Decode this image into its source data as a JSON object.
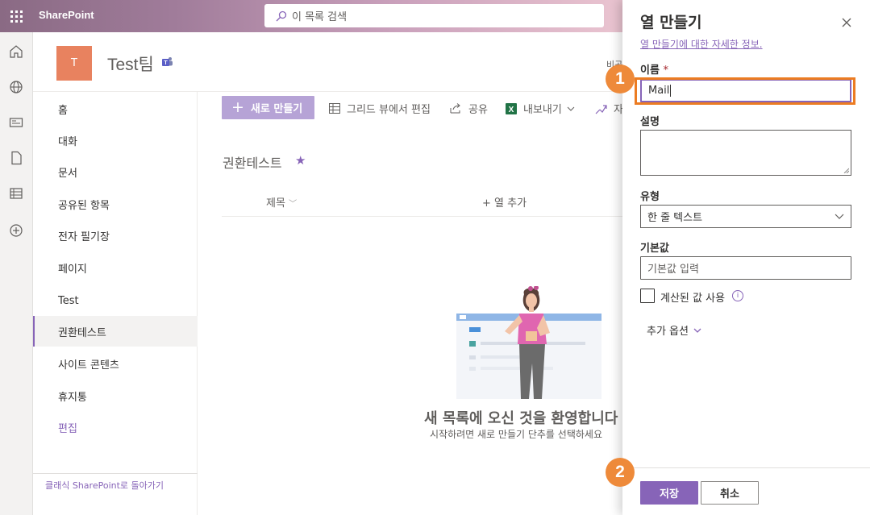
{
  "suite": {
    "brand": "SharePoint",
    "search_placeholder": "이 목록 검색"
  },
  "site": {
    "logo_letter": "T",
    "title": "Test팀",
    "header_right": "비공"
  },
  "nav": {
    "items": [
      "홈",
      "대화",
      "문서",
      "공유된 항목",
      "전자 필기장",
      "페이지",
      "Test",
      "권환테스트",
      "사이트 콘텐츠",
      "휴지통"
    ],
    "edit": "편집",
    "active_index": 7,
    "classic_link": "클래식 SharePoint로 돌아가기"
  },
  "commands": {
    "new": "새로 만들기",
    "grid_edit": "그리드 뷰에서 편집",
    "share": "공유",
    "export": "내보내기",
    "automate": "자"
  },
  "list": {
    "title": "권환테스트",
    "col_title": "제목",
    "add_column": "+ 열 추가",
    "welcome_title": "새 목록에 오신 것을 환영합니다",
    "welcome_sub": "시작하려면 새로 만들기 단추를 선택하세요"
  },
  "panel": {
    "title": "열 만들기",
    "learn_more": "열 만들기에 대한 자세한 정보.",
    "name_label": "이름",
    "required_mark": "*",
    "name_value": "Mail",
    "desc_label": "설명",
    "type_label": "유형",
    "type_value": "한 줄 텍스트",
    "default_label": "기본값",
    "default_placeholder": "기본값 입력",
    "calculated_label": "계산된 값 사용",
    "more_options": "추가 옵션",
    "save": "저장",
    "cancel": "취소"
  },
  "annotations": {
    "badge1": "1",
    "badge2": "2"
  },
  "colors": {
    "accent": "#8764b8",
    "annotation": "#ec7c22"
  }
}
